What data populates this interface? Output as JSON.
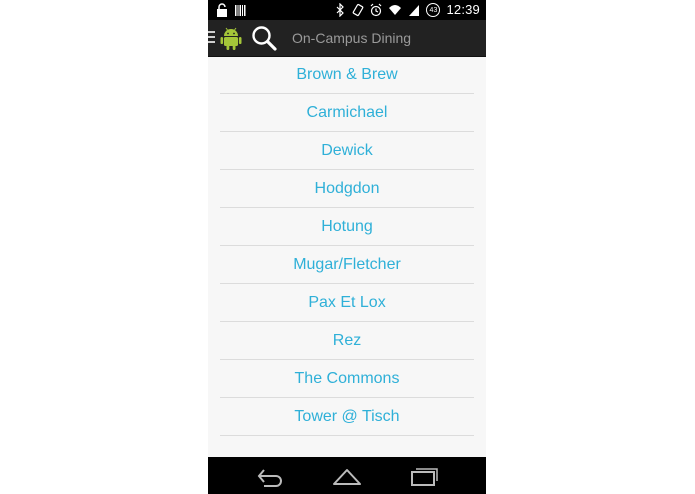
{
  "status_bar": {
    "time": "12:39",
    "battery_level": "43"
  },
  "action_bar": {
    "title": "On-Campus Dining"
  },
  "dining_halls": [
    "Brown & Brew",
    "Carmichael",
    "Dewick",
    "Hodgdon",
    "Hotung",
    "Mugar/Fletcher",
    "Pax Et Lox",
    "Rez",
    "The Commons",
    "Tower @ Tisch"
  ],
  "colors": {
    "accent": "#2fb0d8",
    "action_bar": "#222222",
    "list_bg": "#f7f7f7",
    "android_green": "#a4c639"
  },
  "icons": {
    "drawer": "drawer-menu-icon",
    "app": "android-robot-icon",
    "search": "search-icon",
    "back": "back-icon",
    "home": "home-icon",
    "recent": "recent-apps-icon"
  }
}
